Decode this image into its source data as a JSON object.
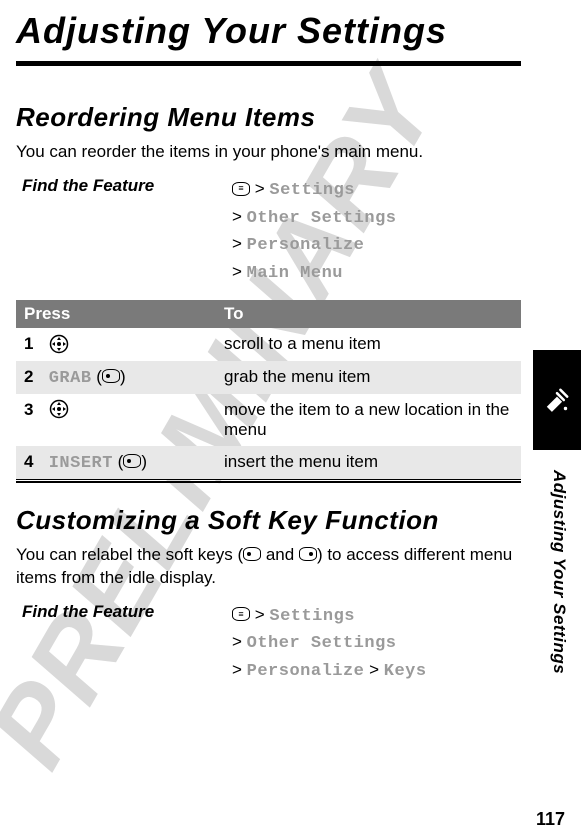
{
  "watermark": "PRELIMINARY",
  "page_title": "Adjusting Your Settings",
  "section1": {
    "heading": "Reordering Menu Items",
    "body": "You can reorder the items in your phone's main menu.",
    "feature_label": "Find the Feature",
    "path": [
      "Settings",
      "Other Settings",
      "Personalize",
      "Main Menu"
    ]
  },
  "table": {
    "headers": [
      "Press",
      "To"
    ],
    "rows": [
      {
        "num": "1",
        "press_icon": "nav",
        "press_label": "",
        "to": "scroll to a menu item"
      },
      {
        "num": "2",
        "press_icon": "softkey-left",
        "press_label": "GRAB",
        "to": "grab the menu item"
      },
      {
        "num": "3",
        "press_icon": "nav",
        "press_label": "",
        "to": "move the item to a new location in the menu"
      },
      {
        "num": "4",
        "press_icon": "softkey-left",
        "press_label": "INSERT",
        "to": "insert the menu item"
      }
    ]
  },
  "section2": {
    "heading": "Customizing a Soft Key Function",
    "body_pre": "You can relabel the soft keys (",
    "body_mid": " and ",
    "body_post": ") to access different menu items from the idle display.",
    "feature_label": "Find the Feature",
    "path": [
      "Settings",
      "Other Settings",
      "Personalize",
      "Keys"
    ]
  },
  "side_label": "Adjusting Your Settings",
  "page_number": "117"
}
